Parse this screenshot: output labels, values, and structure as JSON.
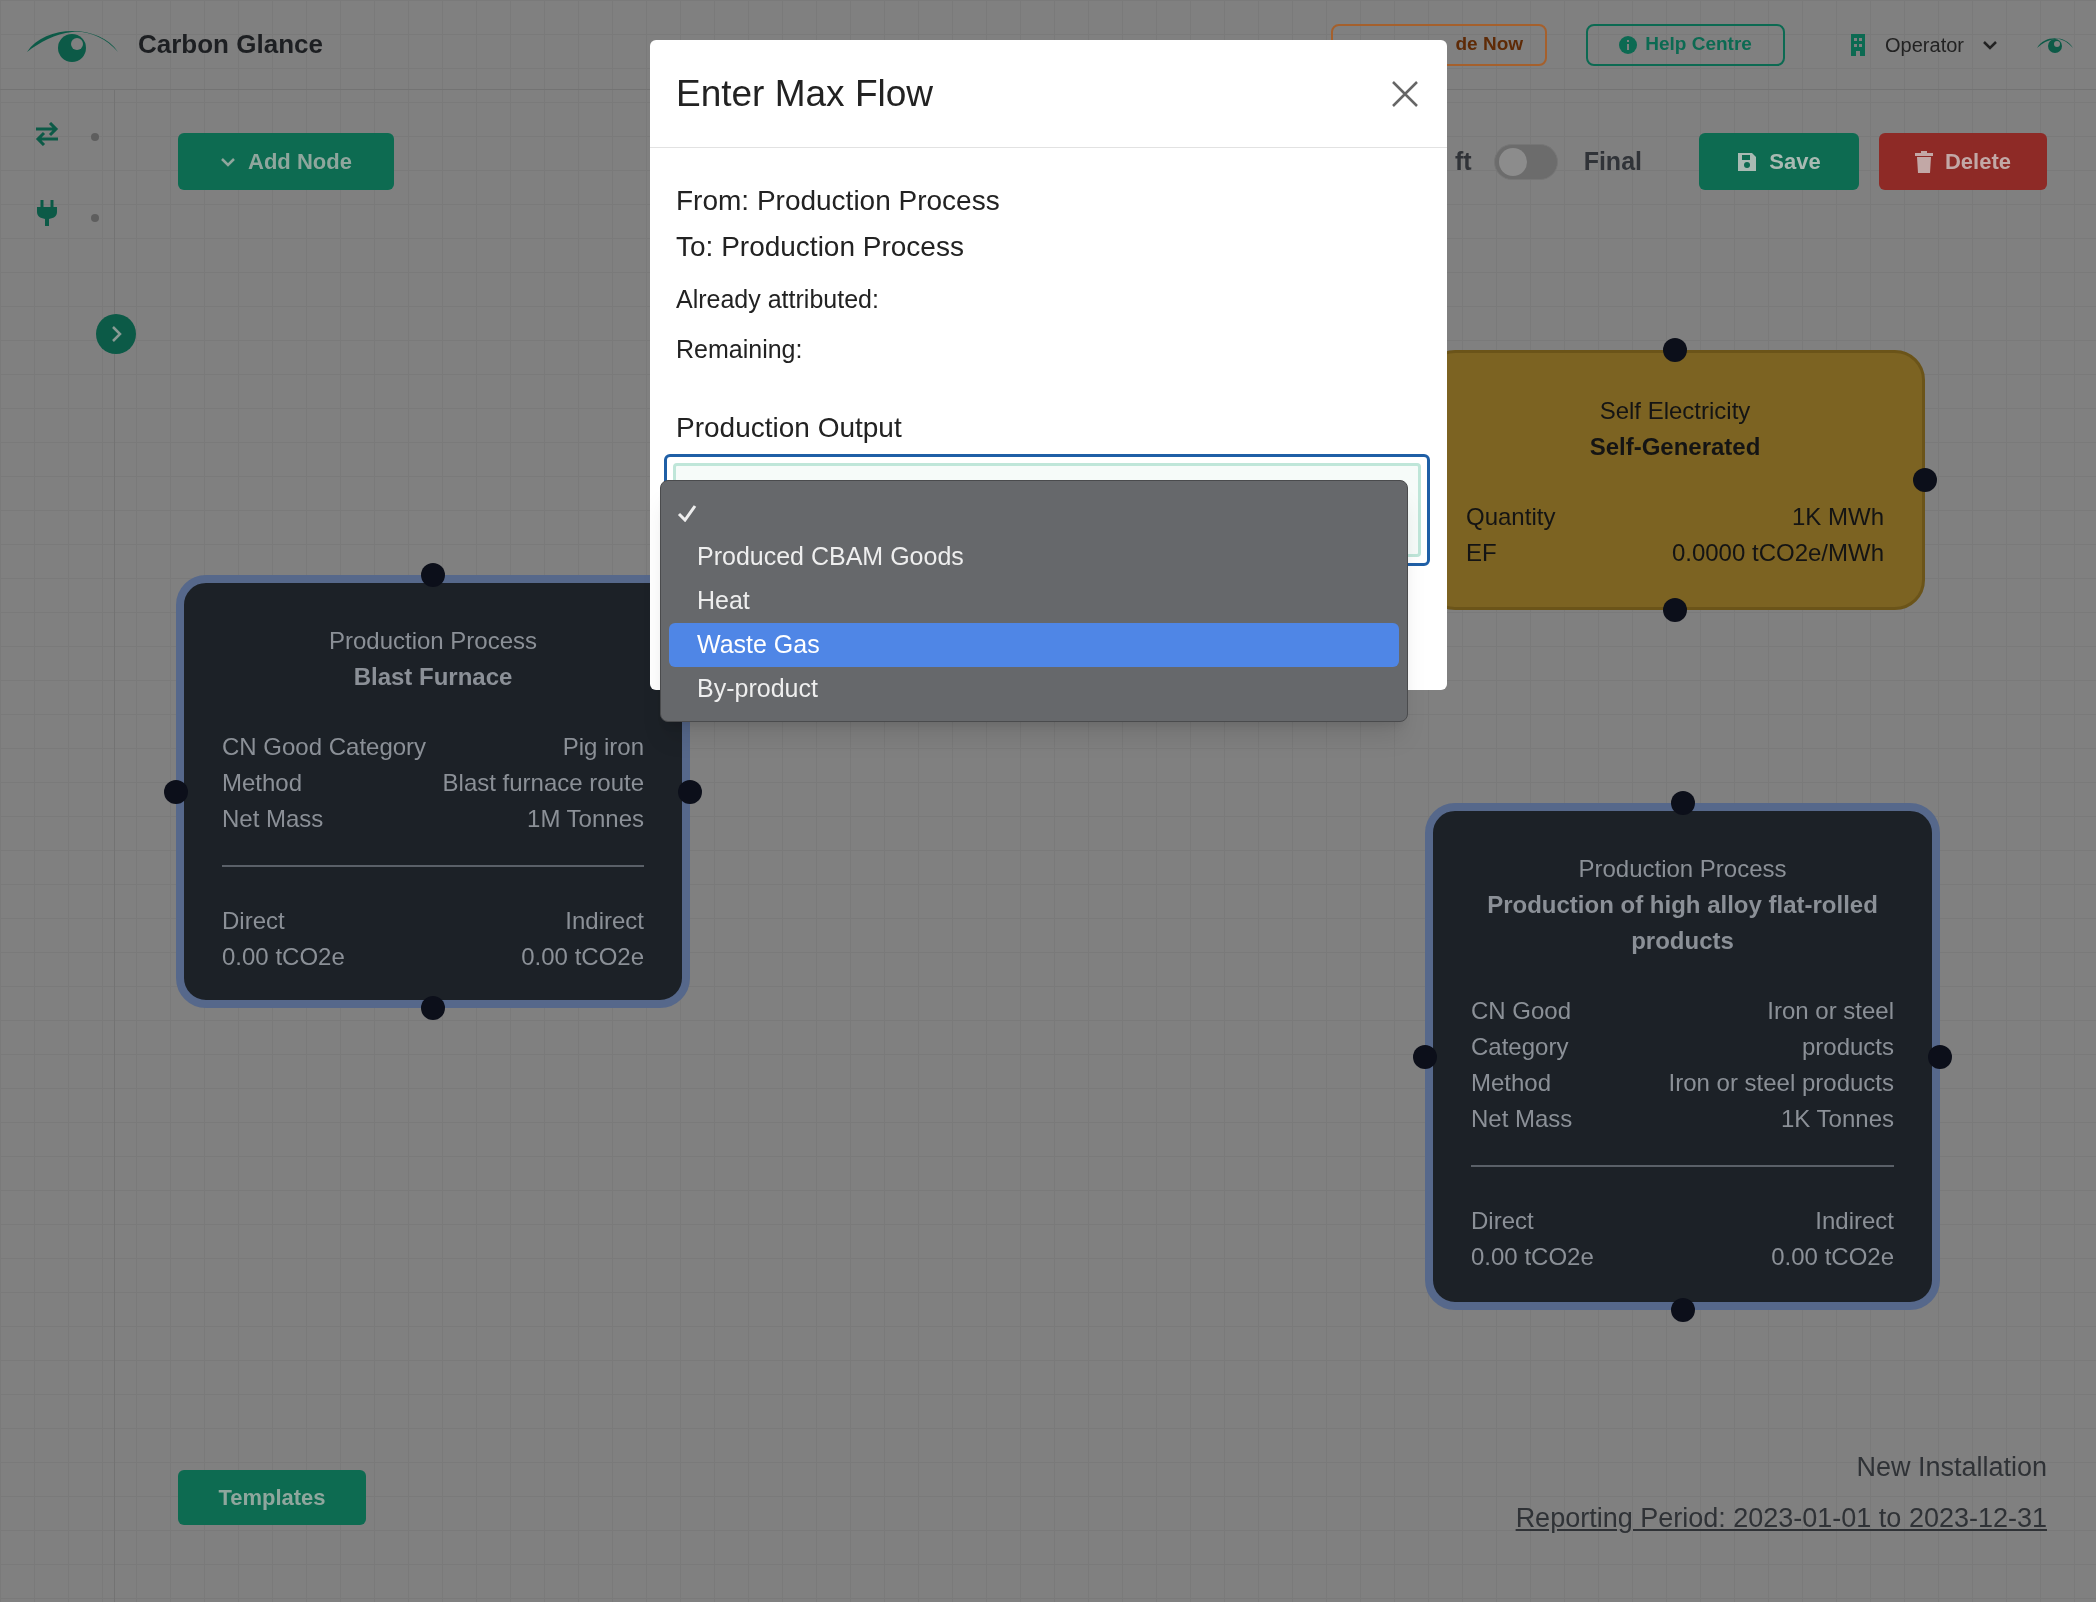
{
  "header": {
    "brand": "Carbon Glance",
    "upgrade_button": "de Now",
    "help_button": "Help Centre",
    "user_menu": "Operator"
  },
  "toolbar": {
    "add_node": "Add Node",
    "status_toggle": {
      "left_label": "ft",
      "right_label": "Final",
      "on": false
    },
    "save": "Save",
    "delete": "Delete"
  },
  "nodes": [
    {
      "kind": "process",
      "type_label": "Production Process",
      "name": "Blast Furnace",
      "fields": [
        {
          "label": "CN Good Category",
          "value": "Pig iron"
        },
        {
          "label": "Method",
          "value": "Blast furnace route"
        },
        {
          "label": "Net Mass",
          "value": "1M Tonnes"
        }
      ],
      "direct_label": "Direct",
      "direct_value": "0.00 tCO2e",
      "indirect_label": "Indirect",
      "indirect_value": "0.00 tCO2e"
    },
    {
      "kind": "electricity",
      "type_label": "Self Electricity",
      "name": "Self-Generated",
      "fields": [
        {
          "label": "Quantity",
          "value": "1K MWh"
        },
        {
          "label": "EF",
          "value": "0.0000 tCO2e/MWh"
        }
      ]
    },
    {
      "kind": "process",
      "type_label": "Production Process",
      "name": "Production of high alloy flat-rolled products",
      "fields": [
        {
          "label": "CN Good Category",
          "value": "Iron or steel products"
        },
        {
          "label": "Method",
          "value": "Iron or steel products"
        },
        {
          "label": "Net Mass",
          "value": "1K Tonnes"
        }
      ],
      "direct_label": "Direct",
      "direct_value": "0.00 tCO2e",
      "indirect_label": "Indirect",
      "indirect_value": "0.00 tCO2e"
    }
  ],
  "footer": {
    "templates_button": "Templates",
    "installation": "New Installation",
    "reporting_period": "Reporting Period: 2023-01-01 to 2023-12-31"
  },
  "modal": {
    "title": "Enter Max Flow",
    "from": "From: Production Process",
    "to": "To: Production Process",
    "already_attributed": "Already attributed:",
    "remaining": "Remaining:",
    "field_label": "Production Output",
    "options": [
      {
        "checked": true,
        "selected": false
      },
      {
        "label": "Produced CBAM Goods",
        "checked": false,
        "selected": false
      },
      {
        "label": "Heat",
        "checked": false,
        "selected": false
      },
      {
        "label": "Waste Gas",
        "checked": false,
        "selected": true
      },
      {
        "label": "By-product",
        "checked": false,
        "selected": false
      }
    ]
  }
}
